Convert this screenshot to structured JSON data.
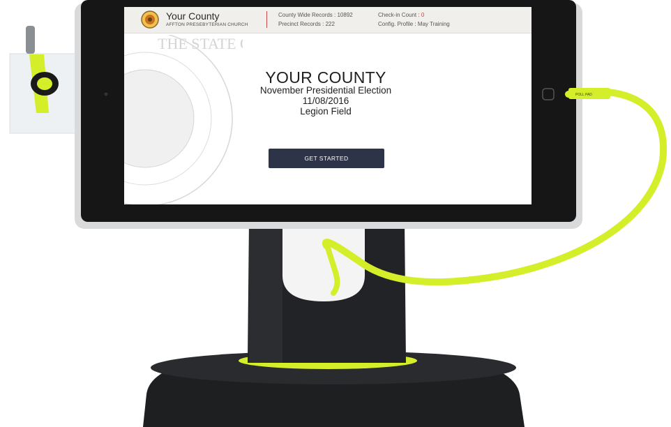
{
  "header": {
    "brand_name": "Your County",
    "brand_subtitle": "AFFTON PRESEBYTERIAN CHURCH",
    "county_records_label": "County Wide Records : 10892",
    "precinct_records_label": "Precinct Records : 222",
    "checkin_label": "Check-in Count : ",
    "checkin_count": "0",
    "config_profile_label": "Config. Profile : May Training"
  },
  "main": {
    "title": "YOUR COUNTY",
    "election_name": "November Presidential Election",
    "election_date": "11/08/2016",
    "location": "Legion Field",
    "get_started_label": "GET STARTED"
  },
  "seal": {
    "text": "THE STATE OF MISSOURI"
  },
  "cable_label": "POLL PAD",
  "colors": {
    "accent_green": "#d5ee2a",
    "button": "#2e3447",
    "header_bg": "#f1efec",
    "checkin_red": "#d23b3b"
  }
}
